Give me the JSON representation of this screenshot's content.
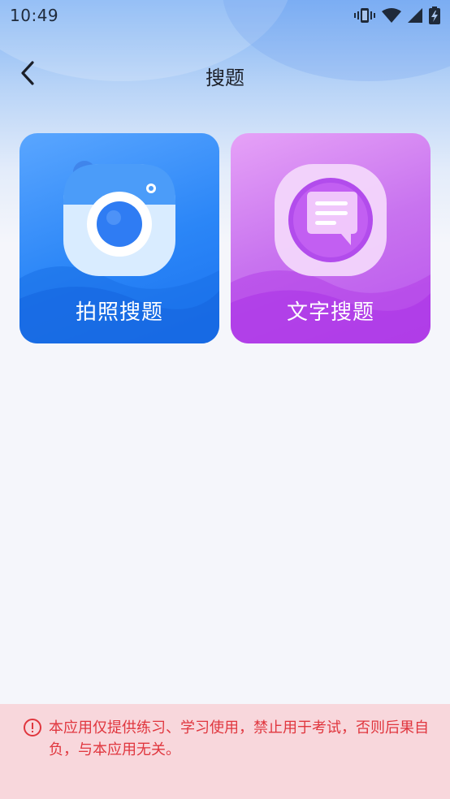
{
  "status_bar": {
    "time": "10:49",
    "icons": [
      "vibrate-icon",
      "wifi-icon",
      "signal-icon",
      "battery-charging-icon"
    ]
  },
  "nav": {
    "back_icon": "chevron-left-icon",
    "title": "搜题"
  },
  "cards": [
    {
      "id": "photo",
      "label": "拍照搜题",
      "icon": "camera-icon",
      "color": "#2b86f7"
    },
    {
      "id": "text",
      "label": "文字搜题",
      "icon": "chat-bubble-icon",
      "color": "#c873ef"
    }
  ],
  "disclaimer": {
    "icon": "warning-icon",
    "text": "本应用仅提供练习、学习使用，禁止用于考试，否则后果自负，与本应用无关。",
    "color": "#e0363e",
    "background": "#f8d7dc"
  }
}
